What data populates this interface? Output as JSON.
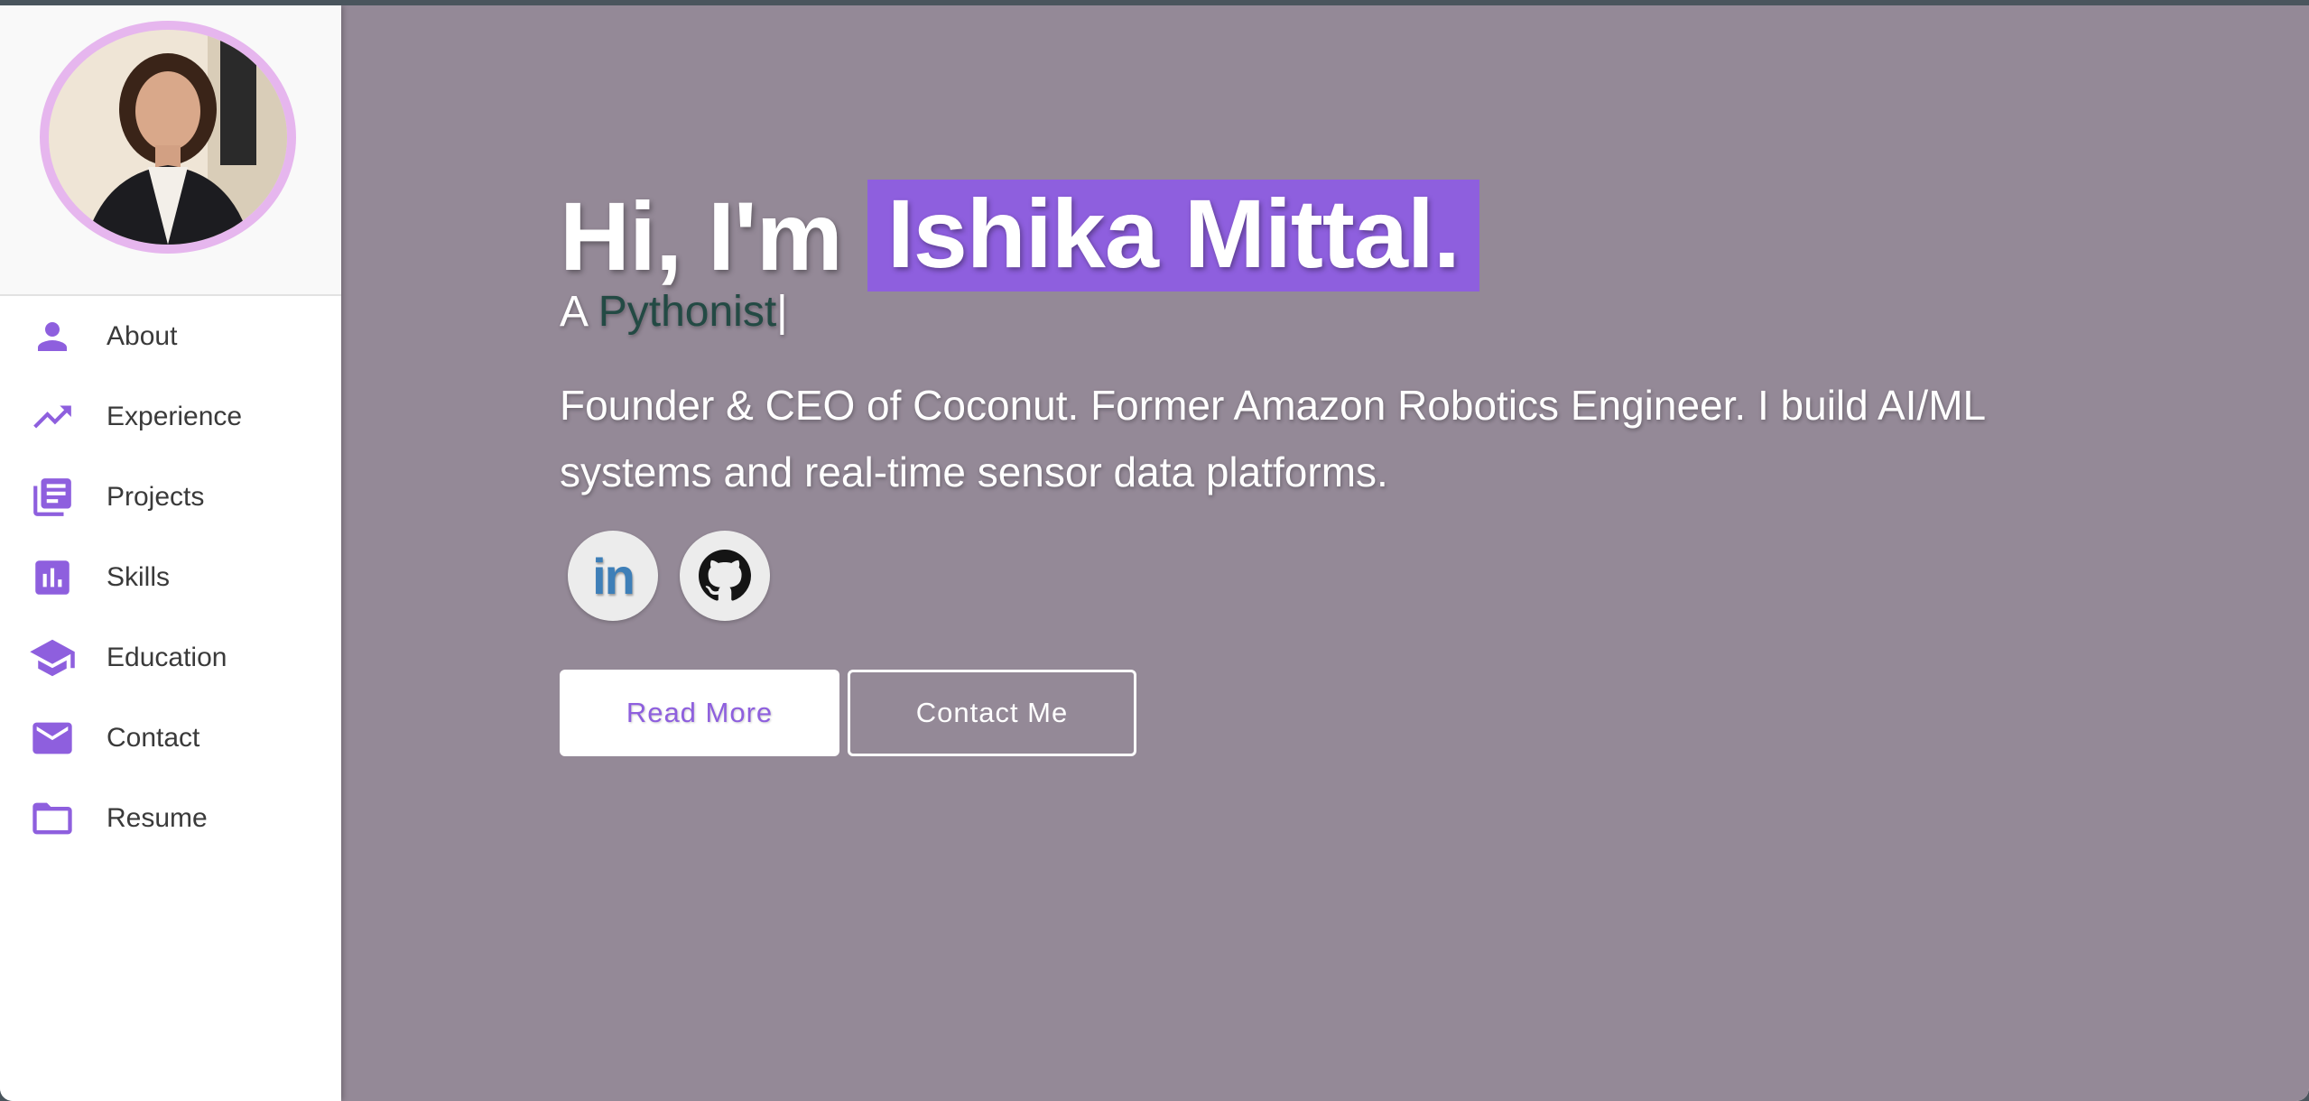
{
  "sidebar": {
    "profile_alt": "Ishika Mittal profile photo",
    "items": [
      {
        "label": "About",
        "icon": "person-icon"
      },
      {
        "label": "Experience",
        "icon": "trending-up-icon"
      },
      {
        "label": "Projects",
        "icon": "library-books-icon"
      },
      {
        "label": "Skills",
        "icon": "bar-chart-icon"
      },
      {
        "label": "Education",
        "icon": "graduation-cap-icon"
      },
      {
        "label": "Contact",
        "icon": "mail-icon"
      },
      {
        "label": "Resume",
        "icon": "folder-icon"
      }
    ]
  },
  "hero": {
    "greeting": "Hi, I'm",
    "name": "Ishika Mittal.",
    "tagline_prefix": "A",
    "tagline_role": "Pythonist",
    "cursor": "|",
    "bio": "Founder & CEO of Coconut. Former Amazon Robotics Engineer. I build AI/ML systems and real-time sensor data platforms.",
    "social": [
      {
        "name": "linkedin",
        "icon": "linkedin-icon"
      },
      {
        "name": "github",
        "icon": "github-icon"
      }
    ],
    "buttons": {
      "read_more": "Read More",
      "contact_me": "Contact Me"
    }
  },
  "colors": {
    "accent": "#8e5fde",
    "hero_bg": "#948997",
    "avatar_ring": "#e6b6ee",
    "role_text": "#234a44"
  }
}
